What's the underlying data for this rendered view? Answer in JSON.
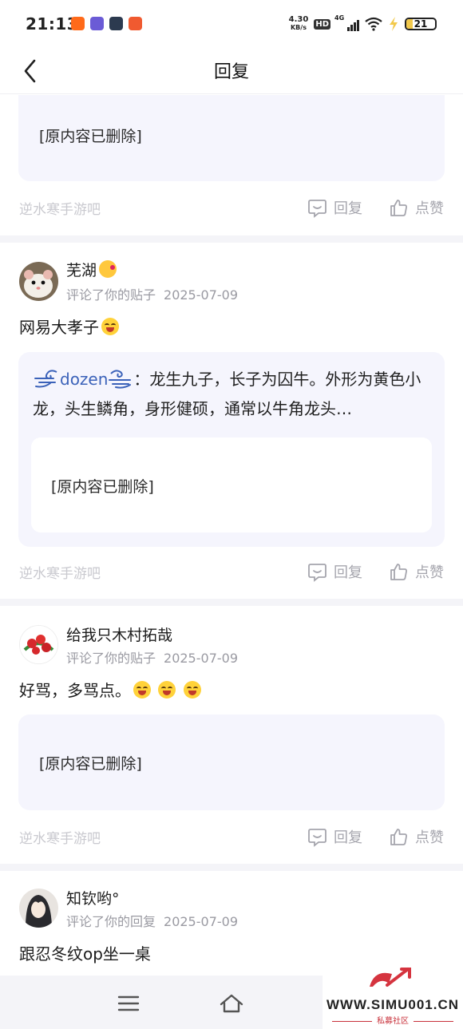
{
  "status_bar": {
    "time": "21:13",
    "net_speed_value": "4.30",
    "net_speed_unit": "KB/s",
    "hd_label": "HD",
    "network_label": "4G",
    "battery_level": "21"
  },
  "header": {
    "title": "回复"
  },
  "action_labels": {
    "reply": "回复",
    "like": "点赞"
  },
  "items": [
    {
      "quote_deleted": "[原内容已删除]",
      "forum": "逆水寒手游吧"
    },
    {
      "username": "芜湖",
      "action": "评论了你的贴子",
      "date": "2025-07-09",
      "content": "网易大孝子",
      "quote_author": "dozen",
      "quote_text": "：龙生九子，长子为囚牛。外形为黄色小龙，头生鳞角，身形健硕，通常以牛角龙头…",
      "inner_deleted": "[原内容已删除]",
      "forum": "逆水寒手游吧"
    },
    {
      "username": "给我只木村拓哉",
      "action": "评论了你的贴子",
      "date": "2025-07-09",
      "content": "好骂，多骂点。",
      "quote_deleted": "[原内容已删除]",
      "forum": "逆水寒手游吧"
    },
    {
      "username": "知钦哟°",
      "action": "评论了你的回复",
      "date": "2025-07-09",
      "content": "跟忍冬纹op坐一桌"
    }
  ],
  "watermark": {
    "text": "WWW.SIMU001.CN",
    "sub": "私募社区"
  },
  "colors": {
    "quote_bg": "#f5f5fd",
    "muted": "#a5a5ad",
    "link_blue": "#3b62b9"
  }
}
